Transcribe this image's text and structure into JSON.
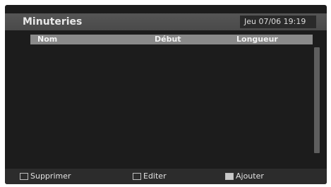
{
  "header": {
    "title": "Minuteries",
    "datetime": "Jeu 07/06 19:19"
  },
  "table": {
    "columns": [
      "Nom",
      "Début",
      "Longueur"
    ],
    "rows": []
  },
  "footer": {
    "buttons": [
      {
        "label": "Supprimer",
        "key_color": "red"
      },
      {
        "label": "Editer",
        "key_color": "green"
      },
      {
        "label": "Ajouter",
        "key_color": "yellow"
      }
    ]
  }
}
